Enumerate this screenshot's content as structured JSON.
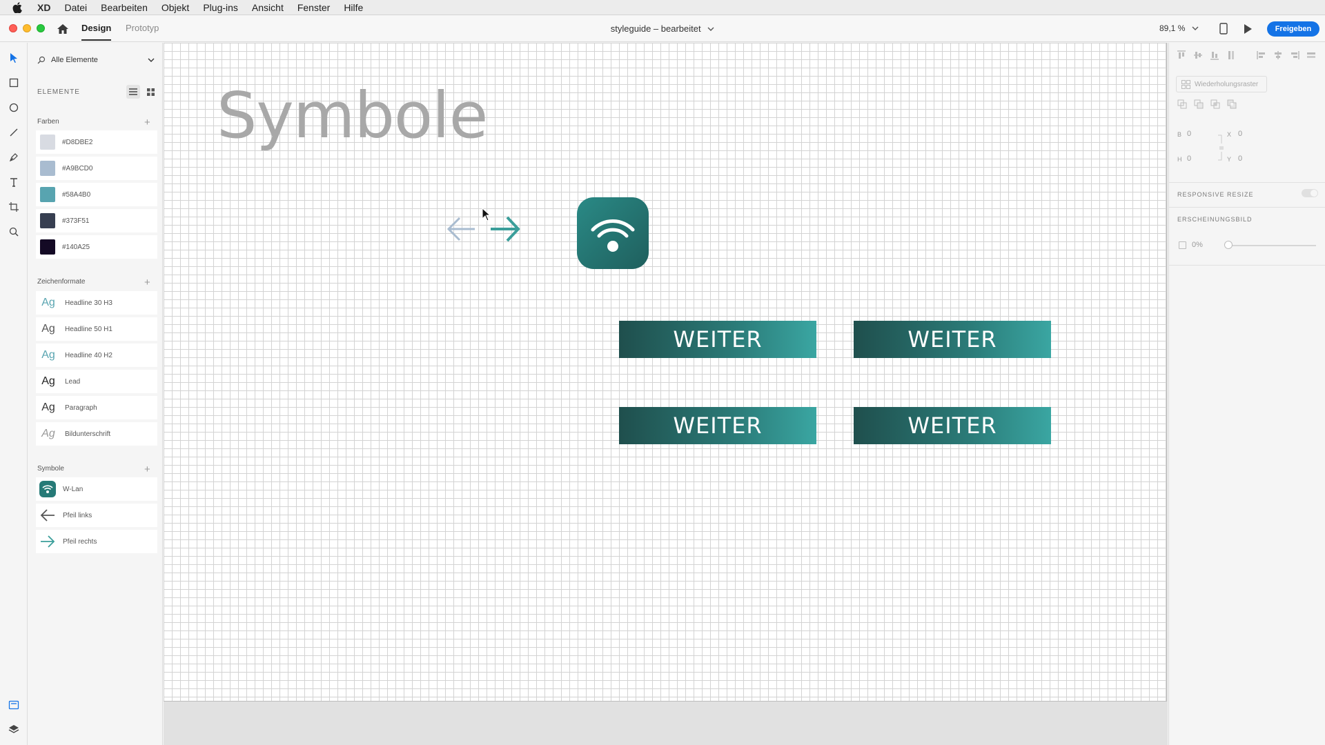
{
  "menubar": {
    "app": "XD",
    "items": [
      "Datei",
      "Bearbeiten",
      "Objekt",
      "Plug-ins",
      "Ansicht",
      "Fenster",
      "Hilfe"
    ]
  },
  "titlebar": {
    "tab_design": "Design",
    "tab_prototype": "Prototyp",
    "document_title": "styleguide – bearbeitet",
    "zoom": "89,1 %",
    "share_label": "Freigeben"
  },
  "assets": {
    "search_placeholder": "Alle Elemente",
    "heading": "ELEMENTE",
    "colors_title": "Farben",
    "colors": [
      {
        "label": "#D8DBE2",
        "hex": "#D8DBE2"
      },
      {
        "label": "#A9BCD0",
        "hex": "#A9BCD0"
      },
      {
        "label": "#58A4B0",
        "hex": "#58A4B0"
      },
      {
        "label": "#373F51",
        "hex": "#373F51"
      },
      {
        "label": "#140A25",
        "hex": "#140A25"
      }
    ],
    "char_styles_title": "Zeichenformate",
    "char_styles": [
      {
        "glyph": "Ag",
        "label": "Headline 30 H3",
        "color": "#58A4B0",
        "style": "normal"
      },
      {
        "glyph": "Ag",
        "label": "Headline 50 H1",
        "color": "#555555",
        "style": "normal"
      },
      {
        "glyph": "Ag",
        "label": "Headline 40 H2",
        "color": "#58A4B0",
        "style": "normal"
      },
      {
        "glyph": "Ag",
        "label": "Lead",
        "color": "#222222",
        "style": "normal"
      },
      {
        "glyph": "Ag",
        "label": "Paragraph",
        "color": "#333333",
        "style": "normal"
      },
      {
        "glyph": "Ag",
        "label": "Bildunterschrift",
        "color": "#999999",
        "style": "italic"
      }
    ],
    "symbols_title": "Symbole",
    "symbols": [
      {
        "icon": "wifi-icon",
        "label": "W-Lan"
      },
      {
        "icon": "arrow-left-icon",
        "label": "Pfeil links"
      },
      {
        "icon": "arrow-right-icon",
        "label": "Pfeil rechts"
      }
    ]
  },
  "canvas": {
    "title": "Symbole",
    "buttons": [
      "WEITER",
      "WEITER",
      "WEITER",
      "WEITER"
    ],
    "accent": "#2B7C79"
  },
  "properties": {
    "repeat_grid_label": "Wiederholungsraster",
    "width_label": "B",
    "width_value": "0",
    "x_label": "X",
    "x_value": "0",
    "height_label": "H",
    "height_value": "0",
    "y_label": "Y",
    "y_value": "0",
    "responsive_resize": "RESPONSIVE RESIZE",
    "appearance": "ERSCHEINUNGSBILD",
    "opacity": "0%"
  }
}
